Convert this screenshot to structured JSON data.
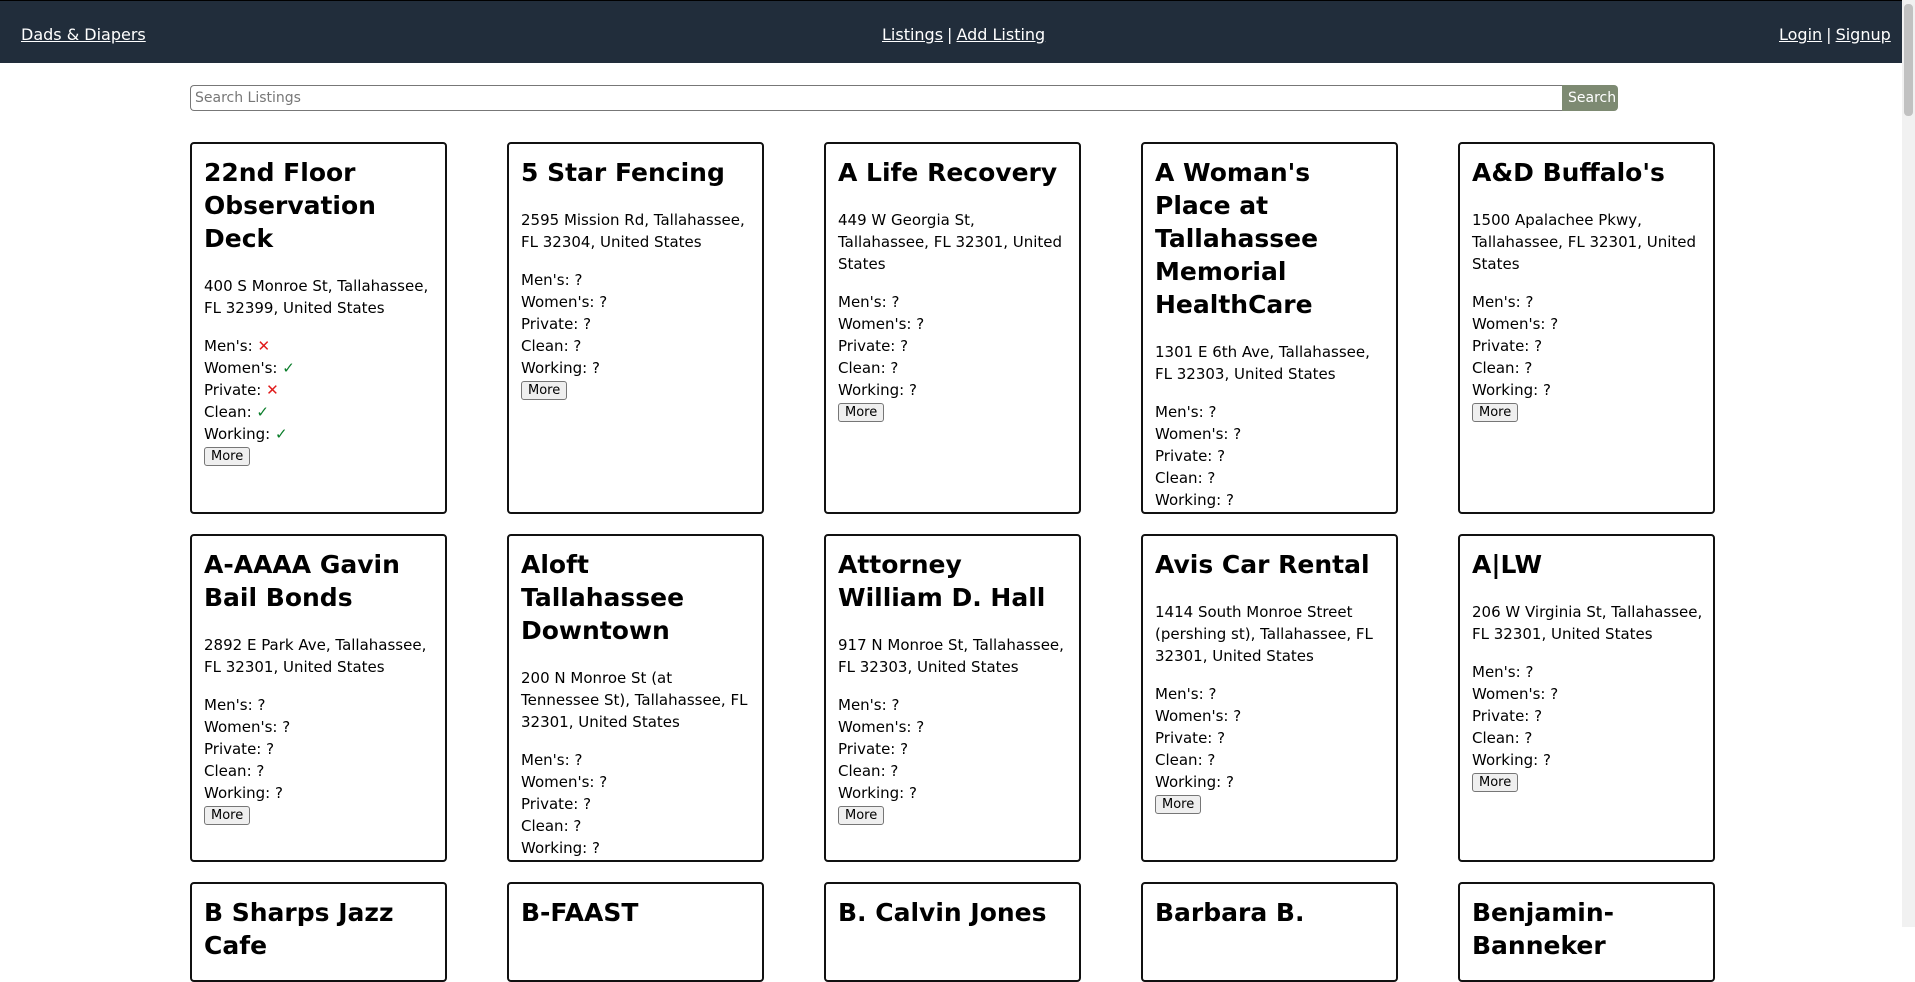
{
  "nav": {
    "brand": "Dads & Diapers",
    "listings": "Listings",
    "add_listing": "Add Listing",
    "login": "Login",
    "signup": "Signup",
    "separator": "|"
  },
  "search": {
    "placeholder": "Search Listings",
    "value": "",
    "button": "Search"
  },
  "labels": {
    "mens": "Men's: ",
    "womens": "Women's: ",
    "private": "Private: ",
    "clean": "Clean: ",
    "working": "Working: ",
    "more": "More"
  },
  "listings": [
    {
      "name": "22nd Floor Observation Deck",
      "address": "400 S Monroe St, Tallahassee, FL 32399, United States",
      "mens": "✕",
      "womens": "✓",
      "private": "✕",
      "clean": "✓",
      "working": "✓"
    },
    {
      "name": "5 Star Fencing",
      "address": "2595 Mission Rd, Tallahassee, FL 32304, United States",
      "mens": "?",
      "womens": "?",
      "private": "?",
      "clean": "?",
      "working": "?"
    },
    {
      "name": "A Life Recovery",
      "address": "449 W Georgia St, Tallahassee, FL 32301, United States",
      "mens": "?",
      "womens": "?",
      "private": "?",
      "clean": "?",
      "working": "?"
    },
    {
      "name": "A Woman's Place at Tallahassee Memorial HealthCare",
      "address": "1301 E 6th Ave, Tallahassee, FL 32303, United States",
      "mens": "?",
      "womens": "?",
      "private": "?",
      "clean": "?",
      "working": "?"
    },
    {
      "name": "A&D Buffalo's",
      "address": "1500 Apalachee Pkwy, Tallahassee, FL 32301, United States",
      "mens": "?",
      "womens": "?",
      "private": "?",
      "clean": "?",
      "working": "?"
    },
    {
      "name": "A-AAAA Gavin Bail Bonds",
      "address": "2892 E Park Ave, Tallahassee, FL 32301, United States",
      "mens": "?",
      "womens": "?",
      "private": "?",
      "clean": "?",
      "working": "?"
    },
    {
      "name": "Aloft Tallahassee Downtown",
      "address": "200 N Monroe St (at Tennessee St), Tallahassee, FL 32301, United States",
      "mens": "?",
      "womens": "?",
      "private": "?",
      "clean": "?",
      "working": "?"
    },
    {
      "name": "Attorney William D. Hall",
      "address": "917 N Monroe St, Tallahassee, FL 32303, United States",
      "mens": "?",
      "womens": "?",
      "private": "?",
      "clean": "?",
      "working": "?"
    },
    {
      "name": "Avis Car Rental",
      "address": "1414 South Monroe Street (pershing st), Tallahassee, FL 32301, United States",
      "mens": "?",
      "womens": "?",
      "private": "?",
      "clean": "?",
      "working": "?"
    },
    {
      "name": "A|LW",
      "address": "206 W Virginia St, Tallahassee, FL 32301, United States",
      "mens": "?",
      "womens": "?",
      "private": "?",
      "clean": "?",
      "working": "?"
    },
    {
      "name": "B Sharps Jazz Cafe"
    },
    {
      "name": "B-FAAST"
    },
    {
      "name": "B. Calvin Jones"
    },
    {
      "name": "Barbara B."
    },
    {
      "name": "Benjamin-Banneker"
    }
  ]
}
